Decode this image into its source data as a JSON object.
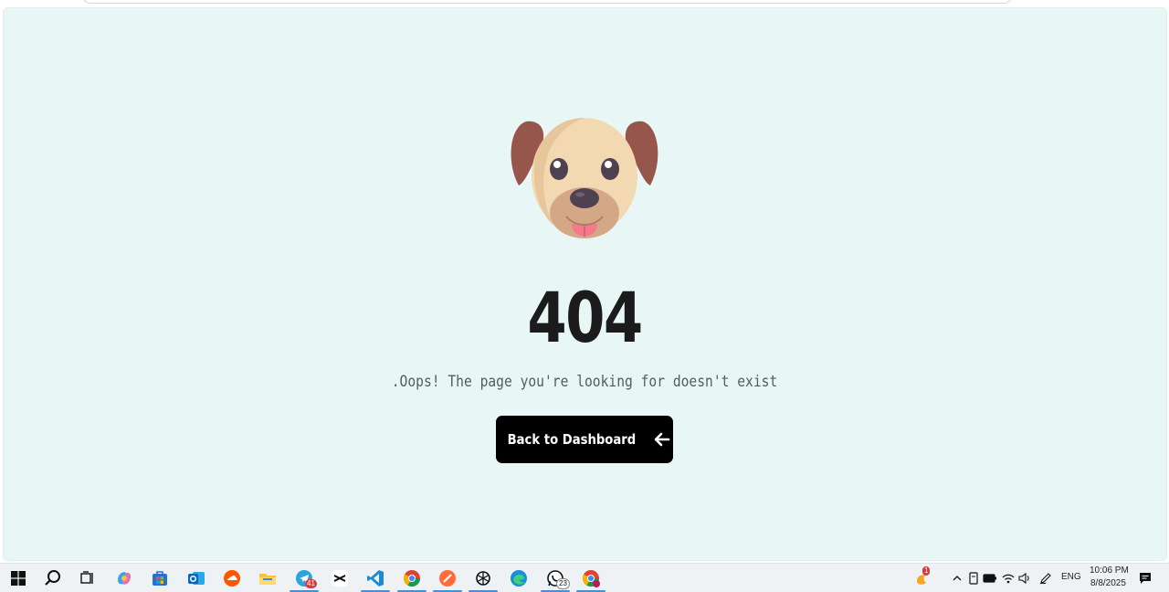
{
  "page": {
    "error_code": "404",
    "message": ".Oops! The page you're looking for doesn't exist",
    "back_button_label": "Back to Dashboard",
    "background_color": "#e8f7f6",
    "button_color": "#000000"
  },
  "taskbar": {
    "apps": [
      {
        "name": "start",
        "icon": "windows-logo-icon"
      },
      {
        "name": "search",
        "icon": "search-icon"
      },
      {
        "name": "task-view",
        "icon": "task-view-icon"
      },
      {
        "name": "copilot",
        "icon": "copilot-icon"
      },
      {
        "name": "store",
        "icon": "store-icon"
      },
      {
        "name": "outlook",
        "icon": "outlook-icon"
      },
      {
        "name": "soundcloud",
        "icon": "soundcloud-icon"
      },
      {
        "name": "file-explorer",
        "icon": "folder-icon"
      },
      {
        "name": "telegram",
        "icon": "telegram-icon",
        "badge": "41"
      },
      {
        "name": "capcut",
        "icon": "capcut-icon"
      },
      {
        "name": "vscode",
        "icon": "vscode-icon"
      },
      {
        "name": "chrome",
        "icon": "chrome-icon"
      },
      {
        "name": "postman",
        "icon": "postman-icon"
      },
      {
        "name": "chatgpt",
        "icon": "chatgpt-icon"
      },
      {
        "name": "edge",
        "icon": "edge-icon"
      },
      {
        "name": "whatsapp",
        "icon": "whatsapp-icon",
        "badge": "23"
      },
      {
        "name": "chrome-profile",
        "icon": "chrome-icon"
      }
    ],
    "weather_badge": "1",
    "language": "ENG",
    "time": "10:06 PM",
    "date": "8/8/2025"
  }
}
